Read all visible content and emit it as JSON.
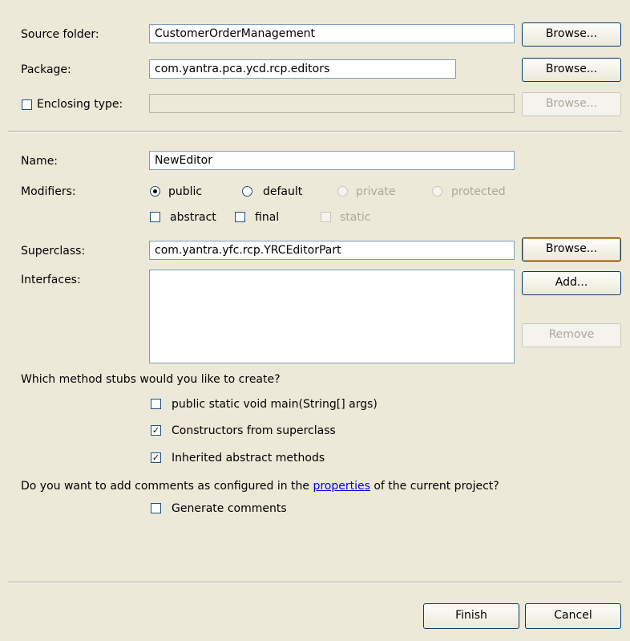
{
  "source_folder": {
    "label": "Source folder:",
    "value": "CustomerOrderManagement",
    "browse": "Browse..."
  },
  "package": {
    "label": "Package:",
    "value": "com.yantra.pca.ycd.rcp.editors",
    "browse": "Browse..."
  },
  "enclosing_type": {
    "label": "Enclosing type:",
    "value": "",
    "checked": false,
    "browse": "Browse..."
  },
  "name": {
    "label": "Name:",
    "value": "NewEditor"
  },
  "modifiers": {
    "label": "Modifiers:",
    "options": [
      "public",
      "default",
      "private",
      "protected"
    ],
    "selected": "public",
    "abstract": "abstract",
    "final": "final",
    "static": "static"
  },
  "superclass": {
    "label": "Superclass:",
    "value": "com.yantra.yfc.rcp.YRCEditorPart",
    "browse": "Browse..."
  },
  "interfaces": {
    "label": "Interfaces:",
    "add": "Add...",
    "remove": "Remove"
  },
  "stubs": {
    "question": "Which method stubs would you like to create?",
    "main": "public static void main(String[] args)",
    "constructors": "Constructors from superclass",
    "inherited": "Inherited abstract methods"
  },
  "comments": {
    "question_before": "Do you want to add comments as configured in the ",
    "question_link": "properties",
    "question_after": " of the current project?",
    "generate": "Generate comments"
  },
  "footer": {
    "finish": "Finish",
    "cancel": "Cancel"
  }
}
